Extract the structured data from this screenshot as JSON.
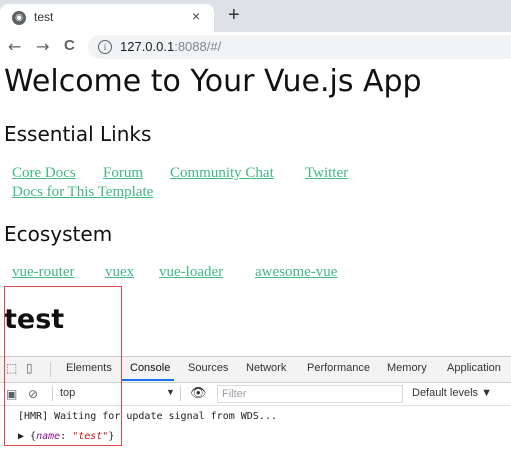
{
  "browser": {
    "tab_title": "test",
    "tab_close": "×",
    "new_tab": "+",
    "url_host": "127.0.0.1",
    "url_rest": ":8088/#/",
    "nav": {
      "back": "←",
      "forward": "→",
      "reload": "C"
    },
    "info_icon_glyph": "i"
  },
  "page": {
    "title": "Welcome to Your Vue.js App",
    "essential_heading": "Essential Links",
    "essential_links": [
      "Core Docs",
      "Forum",
      "Community Chat",
      "Twitter",
      "Docs for This Template"
    ],
    "ecosystem_heading": "Ecosystem",
    "ecosystem_links": [
      "vue-router",
      "vuex",
      "vue-loader",
      "awesome-vue"
    ],
    "component_text": "test"
  },
  "devtools": {
    "tabs": [
      "Elements",
      "Console",
      "Sources",
      "Network",
      "Performance",
      "Memory",
      "Application"
    ],
    "active_tab": "Console",
    "context": "top",
    "filter_placeholder": "Filter",
    "levels": "Default levels ▼",
    "console_lines": {
      "hmr": "[HMR] Waiting for update signal from WDS...",
      "obj_prefix": "▶ {",
      "obj_key": "name",
      "obj_sep": ": ",
      "obj_value": "\"test\"",
      "obj_suffix": "}"
    }
  },
  "colors": {
    "link": "#42b983",
    "devtools_active": "#1a73e8",
    "highlight_box": "#e0474c"
  }
}
